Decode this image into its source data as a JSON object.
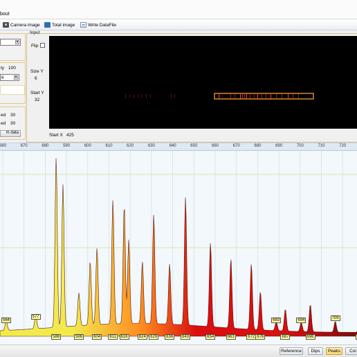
{
  "menu": {
    "about_label": "bout"
  },
  "toolbar": {
    "items": [
      {
        "label": "Camera image",
        "icon": "camera-icon"
      },
      {
        "label": "Total image",
        "icon": "image-icon"
      },
      {
        "label": "Write DataFile",
        "icon": "document-icon"
      }
    ]
  },
  "left_panel": {
    "label_y": "ty",
    "value_y": "100",
    "dropdown_value": "6",
    "speed_label_1": "ed",
    "speed_value_1": "30",
    "speed_label_2": "ed",
    "speed_value_2": "30",
    "button_label": "m data"
  },
  "input_group": {
    "title": "Input",
    "flip_label": "Flip",
    "size_y_label": "Size Y",
    "size_y_value": "6",
    "start_y_label": "Start Y",
    "start_y_value": "32",
    "start_x_label": "Start X",
    "start_x_value": "425"
  },
  "axis_ticks": [
    "660",
    "670",
    "680",
    "590",
    "600",
    "610",
    "620",
    "630",
    "640",
    "650",
    "660",
    "670",
    "680",
    "690",
    "700",
    "710",
    "720"
  ],
  "peak_labels": [
    "564",
    "577",
    "586",
    "596",
    "604",
    "611",
    "616",
    "624",
    "629",
    "636",
    "643",
    "654",
    "663",
    "672",
    "676",
    "683",
    "687",
    "694",
    "698",
    "709",
    "720"
  ],
  "bottom_buttons": [
    {
      "label": "Reference",
      "active": false
    },
    {
      "label": "Dips",
      "active": false
    },
    {
      "label": "Peaks",
      "active": true
    },
    {
      "label": "Col",
      "active": false
    }
  ],
  "chart_data": {
    "type": "area",
    "x": [
      564,
      577,
      586,
      589,
      596,
      601,
      604,
      611,
      616,
      618,
      624,
      629,
      636,
      643,
      654,
      663,
      672,
      676,
      683,
      687,
      694,
      698,
      709,
      720
    ],
    "values": [
      0.05,
      0.07,
      0.93,
      0.78,
      0.18,
      0.35,
      0.42,
      0.68,
      0.65,
      0.46,
      0.34,
      0.6,
      0.33,
      0.7,
      0.46,
      0.38,
      0.36,
      0.21,
      0.05,
      0.12,
      0.05,
      0.15,
      0.06,
      0.38
    ],
    "colors": {
      "low": "#f2ea4d",
      "mid": "#ff8a1e",
      "high": "#d90f10",
      "end": "#7c0a0d",
      "background": "#f2f8fb",
      "grid": "#b7d84c"
    }
  }
}
